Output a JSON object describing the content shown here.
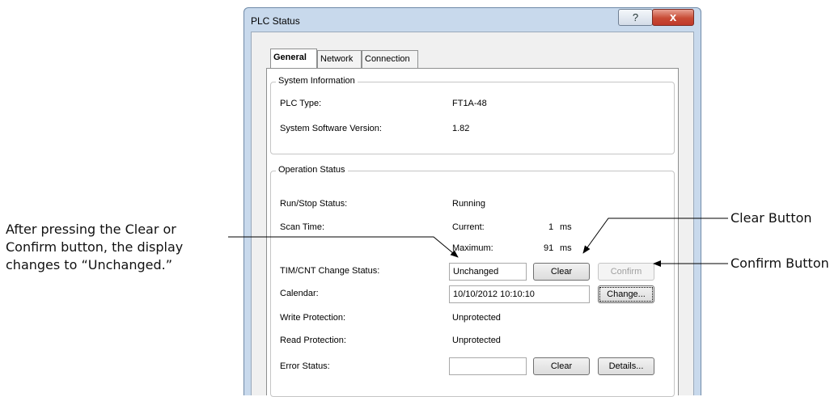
{
  "window": {
    "title": "PLC Status",
    "help_symbol": "?",
    "close_symbol": "x"
  },
  "tabs": [
    "General",
    "Network",
    "Connection"
  ],
  "system_info": {
    "legend": "System Information",
    "plc_type_label": "PLC Type:",
    "plc_type_value": "FT1A-48",
    "version_label": "System Software Version:",
    "version_value": "1.82"
  },
  "operation": {
    "legend": "Operation Status",
    "run_stop_label": "Run/Stop Status:",
    "run_stop_value": "Running",
    "scan_label": "Scan Time:",
    "current_label": "Current:",
    "current_value": "1",
    "current_unit": "ms",
    "maximum_label": "Maximum:",
    "maximum_value": "91",
    "maximum_unit": "ms",
    "timcnt_label": "TIM/CNT Change Status:",
    "timcnt_value": "Unchanged",
    "clear_button": "Clear",
    "confirm_button": "Confirm",
    "calendar_label": "Calendar:",
    "calendar_value": "10/10/2012 10:10:10",
    "change_button": "Change...",
    "write_label": "Write Protection:",
    "write_value": "Unprotected",
    "read_label": "Read Protection:",
    "read_value": "Unprotected",
    "error_label": "Error Status:",
    "error_value": "",
    "error_clear_button": "Clear",
    "details_button": "Details..."
  },
  "annotations": {
    "left": [
      "After pressing the Clear or",
      "Confirm button, the display",
      "changes to “Unchanged.”"
    ],
    "clear": "Clear Button",
    "confirm": "Confirm Button"
  }
}
